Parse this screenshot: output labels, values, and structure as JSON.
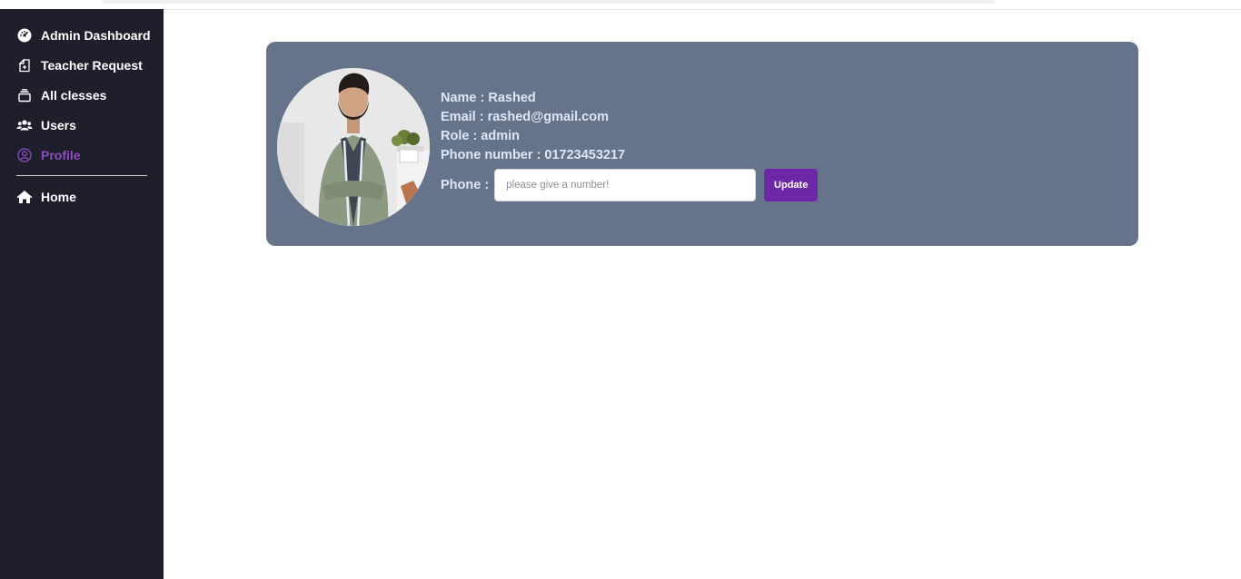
{
  "sidebar": {
    "items": [
      {
        "label": "Admin Dashboard",
        "icon": "dashboard-icon"
      },
      {
        "label": "Teacher Request",
        "icon": "request-icon"
      },
      {
        "label": "All clesses",
        "icon": "classes-icon"
      },
      {
        "label": "Users",
        "icon": "users-icon"
      },
      {
        "label": "Profile",
        "icon": "profile-icon",
        "active": true
      }
    ],
    "footer_items": [
      {
        "label": "Home",
        "icon": "home-icon"
      }
    ],
    "active_color": "#8b4cc4"
  },
  "profile": {
    "name_line": "Name : Rashed",
    "email_line": "Email : rashed@gmail.com",
    "role_line": "Role : admin",
    "phone_line": "Phone number : 01723453217",
    "phone_label": "Phone :",
    "phone_input_value": "",
    "phone_input_placeholder": "please give a number!",
    "update_label": "Update"
  },
  "colors": {
    "sidebar_bg": "#1e1f2b",
    "card_bg": "#66748b",
    "accent": "#6d28a8"
  }
}
